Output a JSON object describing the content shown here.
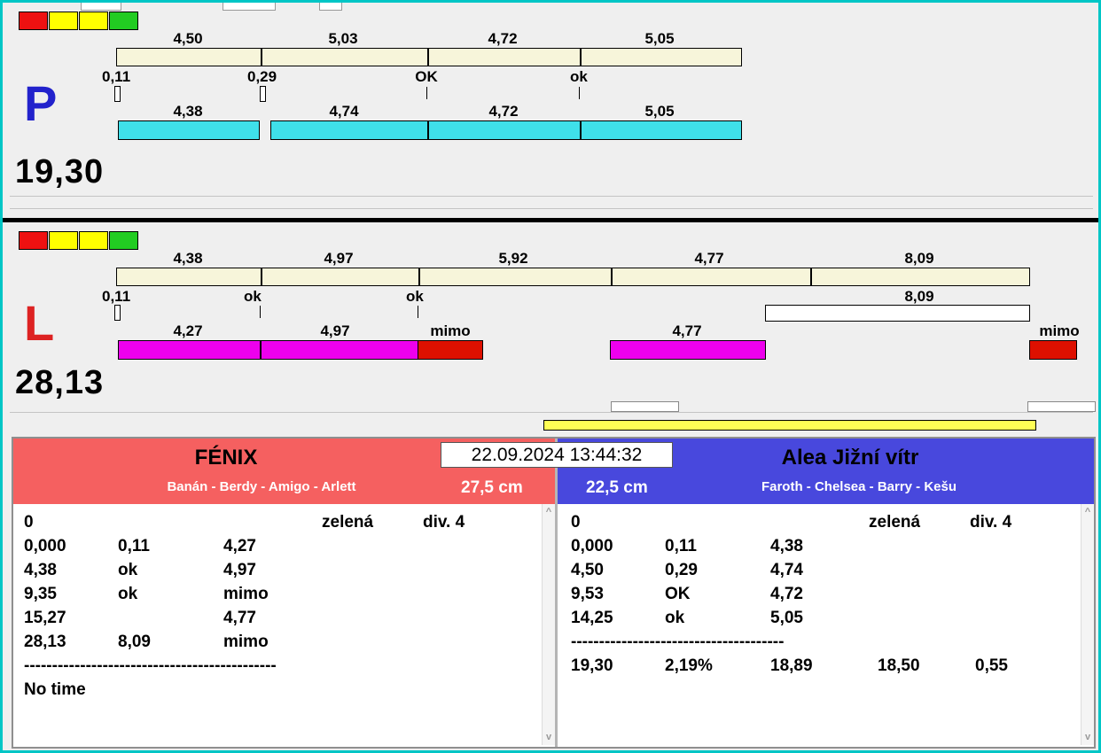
{
  "colors": {
    "window_border": "#00c6c6",
    "bar_cream": "#f7f5da",
    "bar_cyan": "#3fe0ea",
    "bar_magenta": "#ee00ee",
    "bar_red": "#dd1000",
    "bar_yellow": "#ffff55",
    "indicator_colors": [
      "#ee1111",
      "#ffff00",
      "#ffff00",
      "#22cc22"
    ],
    "letter_p": "#2222cc",
    "letter_l": "#dd2222",
    "team_left_bg": "#f56060",
    "team_right_bg": "#4848dd"
  },
  "datetime": "22.09.2024 13:44:32",
  "lane_p": {
    "letter": "P",
    "total": "19,30",
    "split_top": [
      "4,50",
      "5,03",
      "4,72",
      "5,05"
    ],
    "checkpoints": [
      "0,11",
      "0,29",
      "OK",
      "ok"
    ],
    "split_bottom": [
      "4,38",
      "4,74",
      "4,72",
      "5,05"
    ]
  },
  "lane_l": {
    "letter": "L",
    "total": "28,13",
    "split_top": [
      "4,38",
      "4,97",
      "5,92",
      "4,77",
      "8,09"
    ],
    "checkpoints": [
      "0,11",
      "ok",
      "ok",
      "8,09"
    ],
    "split_bottom": [
      "4,27",
      "4,97",
      "mimo",
      "4,77",
      "mimo"
    ]
  },
  "team_left": {
    "name": "FÉNIX",
    "dogs": "Banán - Berdy - Amigo - Arlett",
    "jump_height": "27,5 cm",
    "rows": [
      [
        "0",
        "",
        "",
        "zelená",
        "div. 4"
      ],
      [
        "0,000",
        "0,11",
        "4,27",
        "",
        ""
      ],
      [
        "4,38",
        "ok",
        "4,97",
        "",
        ""
      ],
      [
        "9,35",
        "ok",
        "mimo",
        "",
        ""
      ],
      [
        "15,27",
        "",
        "4,77",
        "",
        ""
      ],
      [
        "28,13",
        "8,09",
        "mimo",
        "",
        ""
      ]
    ],
    "separator": "---------------------------------------------",
    "footer": "No time"
  },
  "team_right": {
    "name": "Alea Jižní vítr",
    "dogs": "Faroth - Chelsea - Barry - Kešu",
    "jump_height": "22,5 cm",
    "rows": [
      [
        "0",
        "",
        "",
        "zelená",
        "div. 4"
      ],
      [
        "0,000",
        "0,11",
        "4,38",
        "",
        ""
      ],
      [
        "4,50",
        "0,29",
        "4,74",
        "",
        ""
      ],
      [
        "9,53",
        "OK",
        "4,72",
        "",
        ""
      ],
      [
        "14,25",
        "ok",
        "5,05",
        "",
        ""
      ]
    ],
    "separator": "--------------------------------------",
    "totals": [
      "19,30",
      "2,19%",
      "18,89",
      "18,50",
      "0,55"
    ]
  },
  "icons": {
    "scroll_up": "^",
    "scroll_down": "v"
  }
}
